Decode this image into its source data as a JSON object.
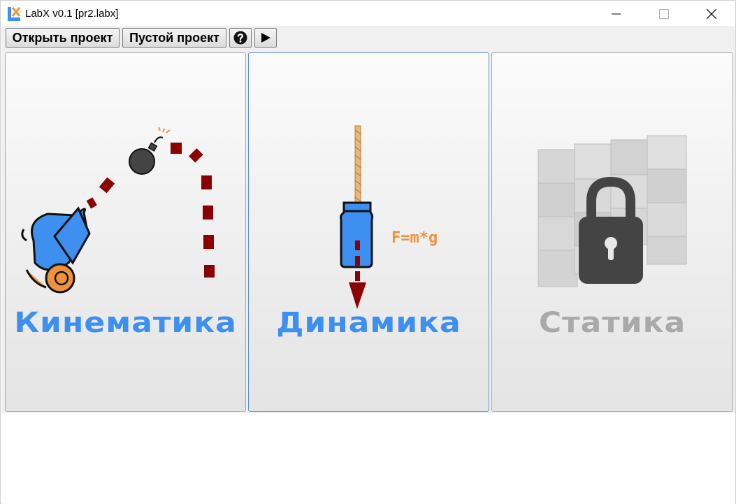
{
  "window": {
    "title": "LabX v0.1 [pr2.labx]",
    "app_icon_letter": "X"
  },
  "toolbar": {
    "open_project_label": "Открыть проект",
    "empty_project_label": "Пустой проект",
    "help_icon": "question-circle-icon",
    "run_icon": "play-icon"
  },
  "panels": [
    {
      "label": "Кинематика",
      "color": "#3d8ff0",
      "icon": "cannon-icon"
    },
    {
      "label": "Динамика",
      "color": "#3d8ff0",
      "icon": "hanging-weight-icon",
      "formula": "F=m*g"
    },
    {
      "label": "Статика",
      "color": "#a9a9a9",
      "icon": "locked-wall-icon"
    }
  ],
  "colors": {
    "accent_blue": "#3d8ff0",
    "dark_red": "#8b0000",
    "orange": "#f0923c",
    "disabled_gray": "#a9a9a9"
  }
}
